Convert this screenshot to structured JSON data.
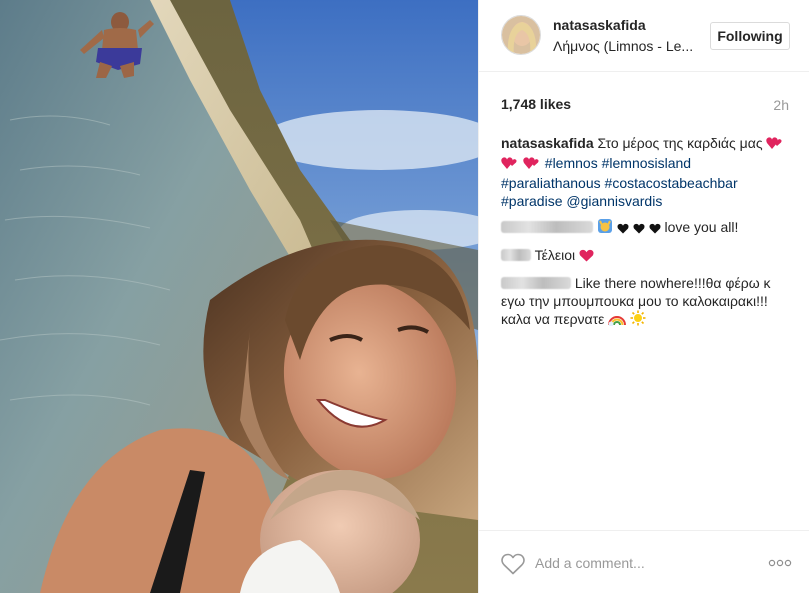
{
  "post": {
    "username": "natasaskafida",
    "location": "Λήμνος (Limnos - Le...",
    "follow_label": "Following",
    "likes": "1,748 likes",
    "time": "2h"
  },
  "caption": {
    "username": "natasaskafida",
    "text": "Στο μέρος της καρδιάς μας",
    "hashtags": [
      "#lemnos",
      "#lemnosisland",
      "#paraliathanous",
      "#costacostabeachbar",
      "#paradise"
    ],
    "mention": "@giannisvardis"
  },
  "comments": [
    {
      "text": "love you all!"
    },
    {
      "text": "Τέλειοι"
    },
    {
      "text": "Like there nowhere!!!θα φέρω κ εγω την μπουμπουκα μου το καλοκαιρακι!!!καλα να περνατε"
    }
  ],
  "footer": {
    "comment_placeholder": "Add a comment...",
    "more_label": "◦◦◦"
  },
  "icons": {
    "like": "heart-outline-icon",
    "more": "more-options-icon"
  },
  "colors": {
    "hashtag": "#003569",
    "heart": "#e0245e",
    "border": "#efefef"
  }
}
